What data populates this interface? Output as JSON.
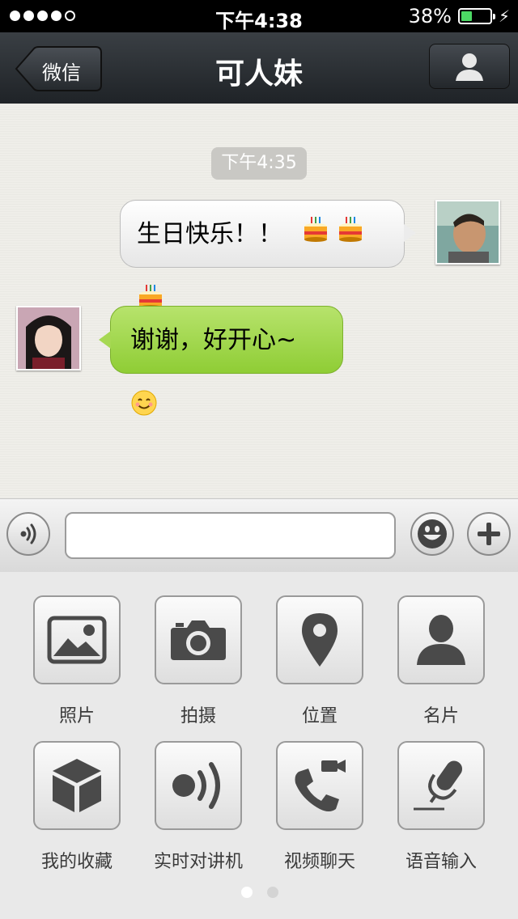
{
  "status_bar": {
    "time": "下午4:38",
    "battery_text": "38%",
    "battery_level": 0.38
  },
  "nav": {
    "back_label": "微信",
    "title": "可人妹"
  },
  "chat": {
    "timestamp": "下午4:35",
    "messages": [
      {
        "direction": "out",
        "text": "生日快乐！！",
        "emoji": [
          "cake",
          "cake",
          "cake"
        ]
      },
      {
        "direction": "in",
        "text": "谢谢，好开心~",
        "emoji": [
          "smile"
        ]
      }
    ]
  },
  "input": {
    "value": "",
    "placeholder": ""
  },
  "panel": {
    "items": [
      {
        "label": "照片",
        "icon": "photo-icon"
      },
      {
        "label": "拍摄",
        "icon": "camera-icon"
      },
      {
        "label": "位置",
        "icon": "location-icon"
      },
      {
        "label": "名片",
        "icon": "contact-card-icon"
      },
      {
        "label": "我的收藏",
        "icon": "favorites-box-icon"
      },
      {
        "label": "实时对讲机",
        "icon": "walkie-talkie-icon"
      },
      {
        "label": "视频聊天",
        "icon": "video-call-icon"
      },
      {
        "label": "语音输入",
        "icon": "microphone-icon"
      }
    ],
    "page_count": 2,
    "current_page": 1
  },
  "colors": {
    "nav_bg": "#2b3035",
    "outgoing_bubble": "#f2f2f2",
    "incoming_bubble": "#a6d853",
    "battery_fill": "#4cd964"
  }
}
